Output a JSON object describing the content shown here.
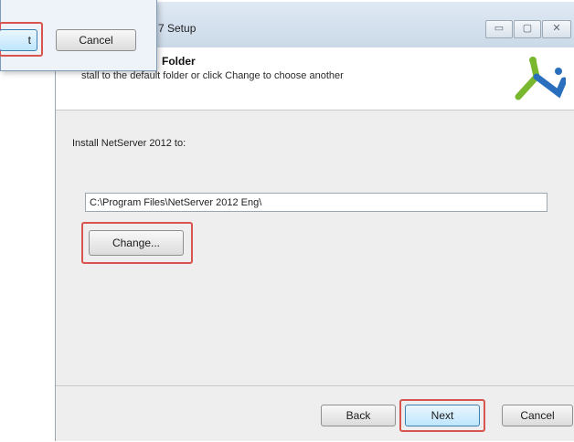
{
  "titlebar": {
    "title": "7 Setup",
    "buttons": [
      "▭",
      "▢",
      "✕"
    ]
  },
  "header": {
    "title": "Folder",
    "description": "stall to the default folder or click Change to choose another"
  },
  "body": {
    "install_label": "Install NetServer 2012 to:",
    "path_value": "C:\\Program Files\\NetServer 2012 Eng\\",
    "change_label": "Change..."
  },
  "footer": {
    "back_label": "Back",
    "next_label": "Next",
    "cancel_label": "Cancel"
  },
  "popup": {
    "ok_label": "t",
    "cancel_label": "Cancel"
  },
  "colors": {
    "highlight": "#d9534f",
    "logo_green": "#79b82e",
    "logo_blue": "#2a6fbd"
  }
}
